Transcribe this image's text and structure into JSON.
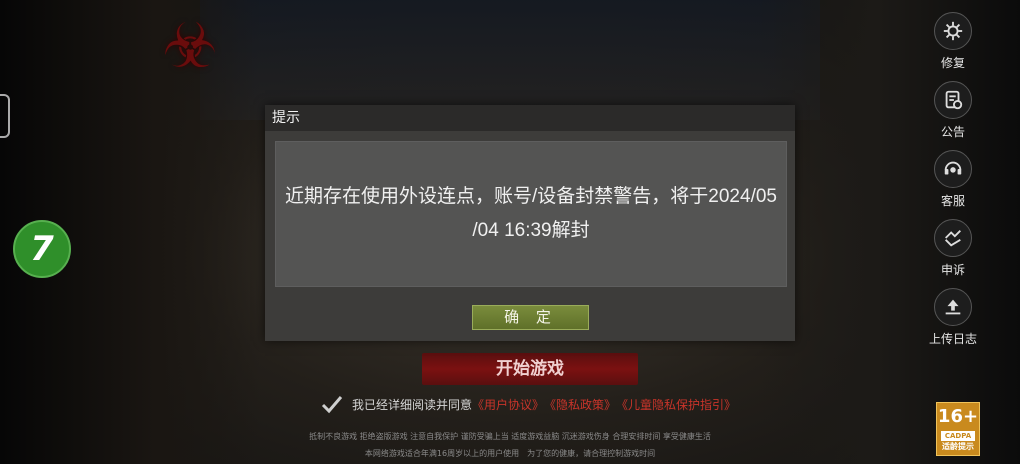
{
  "right_menu": [
    {
      "label": "修复",
      "icon": "gear-icon"
    },
    {
      "label": "公告",
      "icon": "announcement-icon"
    },
    {
      "label": "客服",
      "icon": "customer-service-icon"
    },
    {
      "label": "申诉",
      "icon": "appeal-icon"
    },
    {
      "label": "上传日志",
      "icon": "upload-log-icon"
    }
  ],
  "badge": {
    "text": "7"
  },
  "dialog": {
    "title": "提示",
    "message_line1": "近期存在使用外设连点，账号/设备封禁警告，将于2024/05",
    "message_line2": "/04 16:39解封",
    "confirm_label": "确 定"
  },
  "start_game_label": "开始游戏",
  "agreement": {
    "prefix": "我已经详细阅读并同意",
    "user_agreement": "《用户协议》",
    "privacy_policy": "《隐私政策》",
    "child_privacy": "《儿童隐私保护指引》"
  },
  "health_notice_line1": "抵制不良游戏 拒绝盗版游戏 注意自我保护 谨防受骗上当 适度游戏益脑 沉迷游戏伤身 合理安排时间 享受健康生活",
  "health_notice_line2": "本网络游戏适合年满16周岁以上的用户使用　为了您的健康，请合理控制游戏时间",
  "age_rating": {
    "number": "16+",
    "cadpa": "CADPA",
    "tip": "适龄提示"
  },
  "colors": {
    "accent_red": "#c8342a",
    "confirm_green": "#6b7d31",
    "badge_green": "#2f8f2a",
    "age_orange": "#c98a1e"
  }
}
